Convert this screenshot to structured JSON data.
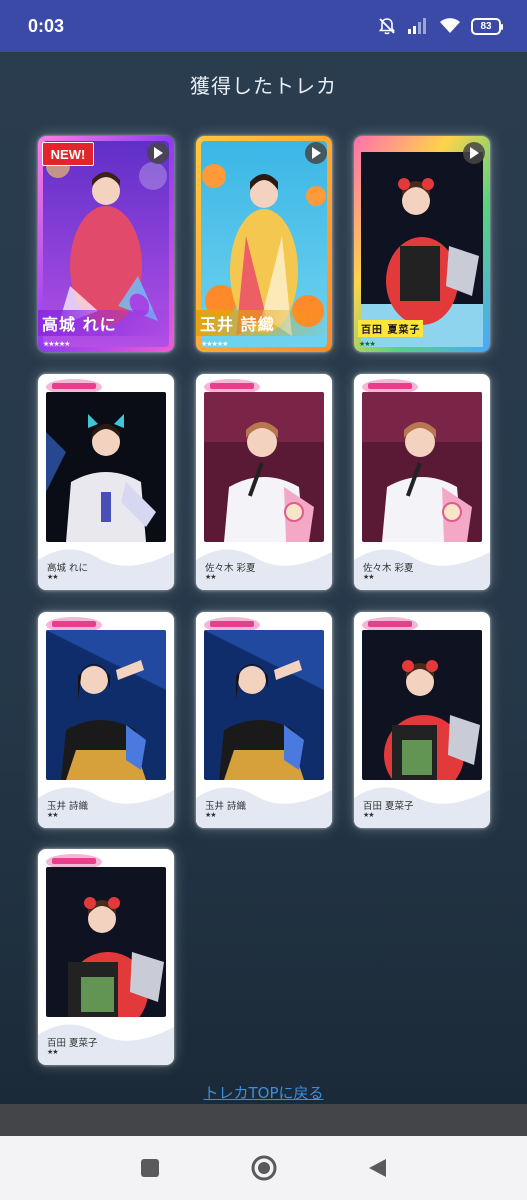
{
  "status_bar": {
    "time": "0:03",
    "battery": "83",
    "icons": [
      "bell-off-icon",
      "signal-icon",
      "wifi-icon",
      "battery-icon"
    ]
  },
  "page": {
    "title": "獲得したトレカ",
    "back_link": "トレカTOPに戻る"
  },
  "cards": [
    {
      "type": "special",
      "name": "高城 れに",
      "stars": "★★★★★",
      "badge": "NEW!",
      "play": true,
      "theme": "purple"
    },
    {
      "type": "special",
      "name": "玉井 詩織",
      "stars": "★★★★★",
      "badge": "",
      "play": true,
      "theme": "yellow"
    },
    {
      "type": "special",
      "name": "百田 夏菜子",
      "stars": "★★★",
      "badge": "",
      "play": true,
      "theme": "rainbow"
    },
    {
      "type": "normal",
      "name": "高城 れに",
      "stars": "★★",
      "theme": "reni"
    },
    {
      "type": "normal",
      "name": "佐々木 彩夏",
      "stars": "★★",
      "theme": "ayaka"
    },
    {
      "type": "normal",
      "name": "佐々木 彩夏",
      "stars": "★★",
      "theme": "ayaka"
    },
    {
      "type": "normal",
      "name": "玉井 詩織",
      "stars": "★★",
      "theme": "shiori"
    },
    {
      "type": "normal",
      "name": "玉井 詩織",
      "stars": "★★",
      "theme": "shiori"
    },
    {
      "type": "normal",
      "name": "百田 夏菜子",
      "stars": "★★",
      "theme": "kanako"
    },
    {
      "type": "normal",
      "name": "百田 夏菜子",
      "stars": "★★",
      "theme": "kanako"
    }
  ],
  "nav_bar": {
    "buttons": [
      "recent-apps-icon",
      "home-icon",
      "back-icon"
    ]
  },
  "colors": {
    "status_bar": "#3b4aa6",
    "background": "#253849",
    "link": "#3b8fe0",
    "badge": "#e0262c"
  }
}
